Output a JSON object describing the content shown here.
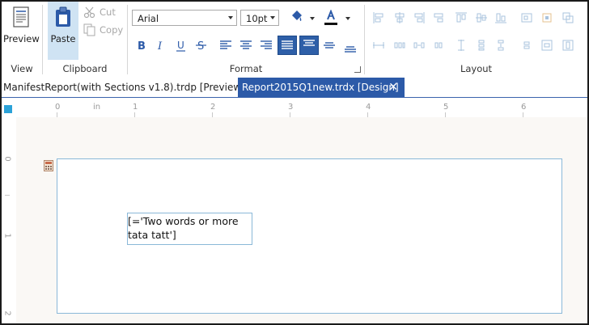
{
  "ribbon": {
    "groups": {
      "view": {
        "label": "View",
        "preview_label": "Preview"
      },
      "clipboard": {
        "label": "Clipboard",
        "paste_label": "Paste",
        "cut_label": "Cut",
        "copy_label": "Copy"
      },
      "format": {
        "label": "Format",
        "font_family": "Arial",
        "font_size": "10pt"
      },
      "layout": {
        "label": "Layout"
      }
    }
  },
  "tabs": [
    {
      "title": "ManifestReport(with Sections v1.8).trdp [Preview]",
      "active": false
    },
    {
      "title": "Report2015Q1new.trdx [Design]",
      "active": true,
      "close": "✕"
    }
  ],
  "ruler": {
    "top_marks": [
      "0",
      "in",
      "1",
      "2",
      "3",
      "4",
      "5",
      "6"
    ],
    "left_marks": [
      "0",
      "1",
      "2"
    ]
  },
  "designer": {
    "textbox_expression": "[='Two words or more tata tatt']"
  },
  "colors": {
    "accent": "#2c5aa8",
    "selected_group": "#cfe3f3",
    "canvas": "#faf8f5",
    "guide": "#8ab8d8"
  }
}
